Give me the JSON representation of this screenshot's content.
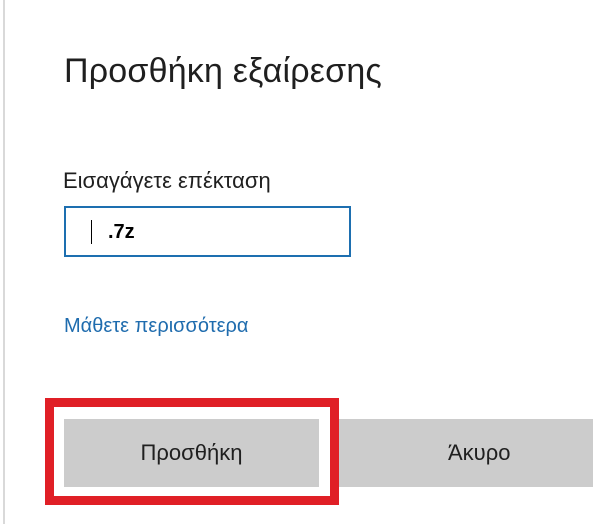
{
  "dialog": {
    "title": "Προσθήκη εξαίρεσης",
    "field_label": "Εισαγάγετε επέκταση",
    "input_value": ".7z",
    "learn_more_link": "Μάθετε περισσότερα",
    "add_button_label": "Προσθήκη",
    "cancel_button_label": "Άκυρο"
  },
  "colors": {
    "link": "#1f6cae",
    "input_border": "#1d6fb0",
    "button_bg": "#cccccc",
    "highlight": "#e01f26"
  }
}
